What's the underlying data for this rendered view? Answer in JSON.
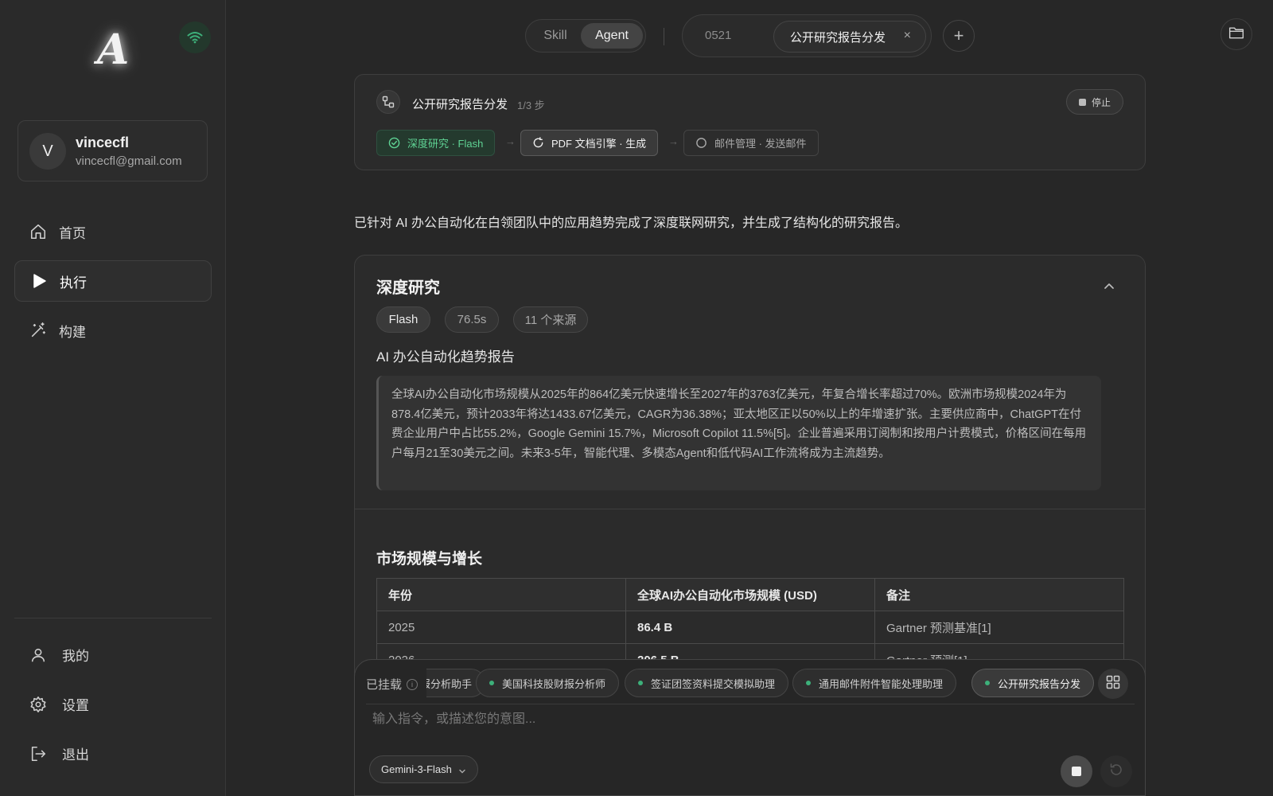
{
  "app": {
    "logo_text": "A",
    "logo_icon": "app-logo-icon",
    "status_icon": "wifi-icon",
    "status_color": "#3db07a"
  },
  "user": {
    "initial": "V",
    "name": "vincecfl",
    "email": "vincecfl@gmail.com"
  },
  "sidebar": {
    "items": [
      {
        "label": "首页",
        "icon": "home-icon"
      },
      {
        "label": "执行",
        "icon": "play-icon",
        "active": true
      },
      {
        "label": "构建",
        "icon": "magic-wand-icon"
      }
    ],
    "bottom": [
      {
        "label": "我的",
        "icon": "user-icon"
      },
      {
        "label": "设置",
        "icon": "gear-icon"
      },
      {
        "label": "退出",
        "icon": "logout-icon"
      }
    ]
  },
  "topbar": {
    "mode_options": [
      "Skill",
      "Agent"
    ],
    "mode_selected": "Agent",
    "tabs": [
      {
        "label": "0521"
      },
      {
        "label": "公开研究报告分发",
        "active": true,
        "close": "×"
      }
    ],
    "add_tab": "+",
    "folder_icon": "folder-icon"
  },
  "workflow": {
    "title": "公开研究报告分发",
    "step": "1/3 步",
    "stop_label": "停止",
    "steps": [
      {
        "label": "深度研究 · Flash",
        "status": "done",
        "icon": "check-circle-icon"
      },
      {
        "label": "PDF 文档引擎 · 生成",
        "status": "running",
        "icon": "loading-icon"
      },
      {
        "label": "邮件管理 · 发送邮件",
        "status": "pending",
        "icon": "circle-icon"
      }
    ],
    "arrow": "→"
  },
  "message": {
    "summary": "已针对 AI 办公自动化在白领团队中的应用趋势完成了深度联网研究，并生成了结构化的研究报告。"
  },
  "research": {
    "title": "深度研究",
    "tags": [
      "Flash",
      "76.5s",
      "11 个来源"
    ],
    "report_title": "AI 办公自动化趋势报告",
    "abstract": "全球AI办公自动化市场规模从2025年的864亿美元快速增长至2027年的3763亿美元，年复合增长率超过70%。欧洲市场规模2024年为878.4亿美元，预计2033年将达1433.67亿美元，CAGR为36.38%；亚太地区正以50%以上的年增速扩张。主要供应商中，ChatGPT在付费企业用户中占比55.2%，Google Gemini 15.7%，Microsoft Copilot 11.5%[5]。企业普遍采用订阅制和按用户计费模式，价格区间在每用户每月21至30美元之间。未来3-5年，智能代理、多模态Agent和低代码AI工作流将成为主流趋势。",
    "section_title": "市场规模与增长",
    "table": {
      "headers": [
        "年份",
        "全球AI办公自动化市场规模 (USD)",
        "备注"
      ],
      "rows": [
        [
          "2025",
          "86.4 B",
          "Gartner 预测基准[1]"
        ],
        [
          "2026",
          "206.5 B",
          "Gartner 预测[1]"
        ]
      ]
    }
  },
  "composer": {
    "mounted_label": "已挂载",
    "info_icon": "i",
    "skills": [
      {
        "label": "研报分析助手"
      },
      {
        "label": "美国科技股财报分析师"
      },
      {
        "label": "签证团签资料提交模拟助理"
      },
      {
        "label": "通用邮件附件智能处理助理"
      },
      {
        "label": "公开研究报告分发",
        "active": true
      }
    ],
    "grid_icon": "grid-icon",
    "placeholder": "输入指令，或描述您的意图...",
    "model": "Gemini-3-Flash",
    "stop_icon": "stop-icon",
    "refresh_icon": "refresh-icon"
  }
}
